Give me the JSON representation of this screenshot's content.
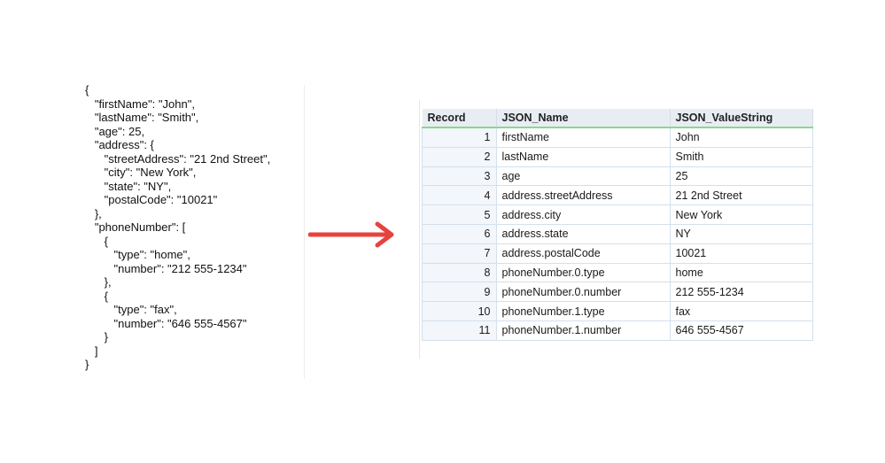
{
  "json_source": {
    "lines": [
      "{",
      "   \"firstName\": \"John\",",
      "   \"lastName\": \"Smith\",",
      "   \"age\": 25,",
      "   \"address\": {",
      "      \"streetAddress\": \"21 2nd Street\",",
      "      \"city\": \"New York\",",
      "      \"state\": \"NY\",",
      "      \"postalCode\": \"10021\"",
      "   },",
      "   \"phoneNumber\": [",
      "      {",
      "         \"type\": \"home\",",
      "         \"number\": \"212 555-1234\"",
      "      },",
      "      {",
      "         \"type\": \"fax\",",
      "         \"number\": \"646 555-4567\"",
      "      }",
      "   ]",
      "}"
    ]
  },
  "arrow": {
    "icon": "right-arrow-icon",
    "color": "#e8423f"
  },
  "table": {
    "columns": [
      "Record",
      "JSON_Name",
      "JSON_ValueString"
    ],
    "rows": [
      {
        "record": "1",
        "name": "firstName",
        "value": "John"
      },
      {
        "record": "2",
        "name": "lastName",
        "value": "Smith"
      },
      {
        "record": "3",
        "name": "age",
        "value": "25"
      },
      {
        "record": "4",
        "name": "address.streetAddress",
        "value": "21 2nd Street"
      },
      {
        "record": "5",
        "name": "address.city",
        "value": "New York"
      },
      {
        "record": "6",
        "name": "address.state",
        "value": "NY"
      },
      {
        "record": "7",
        "name": "address.postalCode",
        "value": "10021"
      },
      {
        "record": "8",
        "name": "phoneNumber.0.type",
        "value": "home"
      },
      {
        "record": "9",
        "name": "phoneNumber.0.number",
        "value": "212 555-1234"
      },
      {
        "record": "10",
        "name": "phoneNumber.1.type",
        "value": "fax"
      },
      {
        "record": "11",
        "name": "phoneNumber.1.number",
        "value": "646 555-4567"
      }
    ],
    "header_bg": "#e7edf3",
    "header_accent": "#8dd68d"
  }
}
